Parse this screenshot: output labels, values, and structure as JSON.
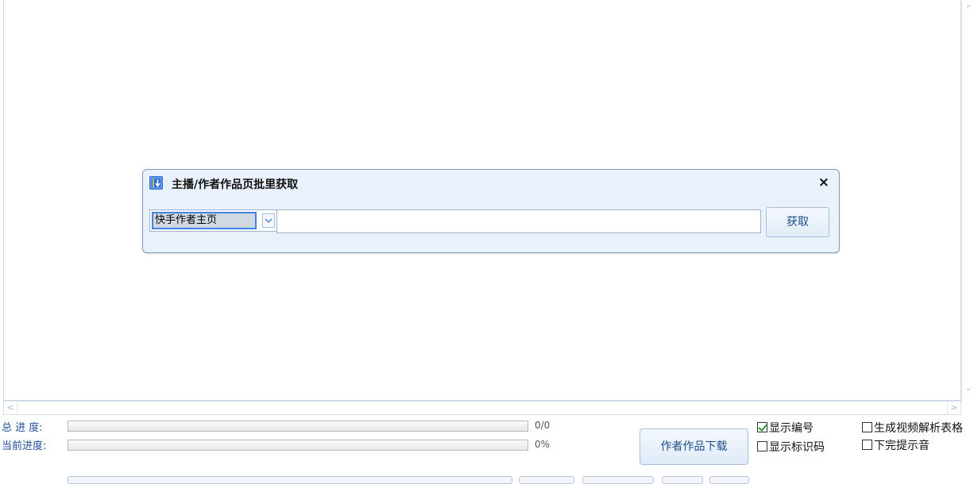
{
  "dialog": {
    "title": "主播/作者作品页批里获取",
    "close_label": "×",
    "source_select_value": "快手作者主页",
    "url_input_value": "",
    "fetch_button_label": "获取"
  },
  "scrollbars": {
    "up_arrow": "⌃",
    "down_arrow": "⌄",
    "left_arrow": "<",
    "right_arrow": ">"
  },
  "progress": {
    "total_label": "总 进 度:",
    "total_text": "0/0",
    "total_fraction": 0,
    "current_label": "当前进度:",
    "current_text": "0%",
    "current_fraction": 0
  },
  "actions": {
    "download_button_label": "作者作品下载"
  },
  "options": {
    "show_number": {
      "label": "显示编号",
      "checked": true
    },
    "show_id_code": {
      "label": "显示标识码",
      "checked": false
    },
    "generate_table": {
      "label": "生成视频解析表格",
      "checked": false
    },
    "finish_sound": {
      "label": "下完提示音",
      "checked": false
    }
  },
  "colors": {
    "accent": "#1f4e90",
    "label_blue": "#1f4f9a",
    "dialog_bg": "#e9f1fa",
    "check_green": "#2a9a2a"
  },
  "icons": {
    "dialog_icon": "download-arrow-icon",
    "dropdown": "chevron-down-icon",
    "close": "close-icon"
  }
}
